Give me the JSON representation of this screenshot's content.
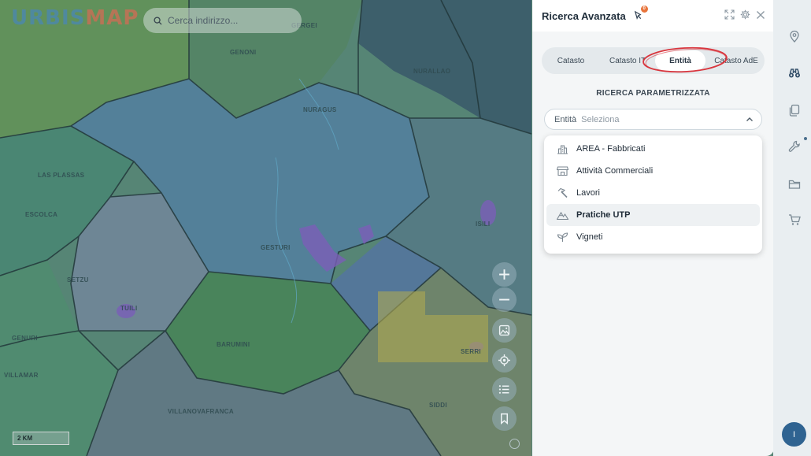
{
  "app": {
    "logo_part1": "URBIS",
    "logo_part2": "MAP"
  },
  "search": {
    "placeholder": "Cerca indirizzo..."
  },
  "map": {
    "scale_label": "2 KM",
    "places": [
      "GENONI",
      "NURAGUS",
      "NURALLAO",
      "GESTURI",
      "ISILI",
      "TUILI",
      "SETZU",
      "GENURI",
      "BARUMINI",
      "SERRI",
      "ESCOLCA",
      "LAS PLASSAS",
      "VILLANOVAFRANCA",
      "GERGEI",
      "VILLAMAR",
      "SIDDI"
    ]
  },
  "panel": {
    "title": "Ricerca Avanzata",
    "badge_count": "0",
    "tabs": [
      {
        "label": "Catasto"
      },
      {
        "label": "Catasto IT"
      },
      {
        "label": "Entità"
      },
      {
        "label": "Catasto AdE"
      }
    ],
    "section_title": "RICERCA PARAMETRIZZATA",
    "select": {
      "label": "Entità",
      "placeholder": "Seleziona"
    },
    "options": [
      {
        "label": "AREA - Fabbricati",
        "icon": "building-icon"
      },
      {
        "label": "Attività Commerciali",
        "icon": "store-icon"
      },
      {
        "label": "Lavori",
        "icon": "hammer-icon"
      },
      {
        "label": "Pratiche UTP",
        "icon": "mountain-icon"
      },
      {
        "label": "Vigneti",
        "icon": "leaf-icon"
      }
    ]
  },
  "user": {
    "avatar_initial": "I"
  },
  "colors": {
    "accent": "#2f6391",
    "highlight_ring": "#d9363e",
    "badge": "#e8743b"
  }
}
